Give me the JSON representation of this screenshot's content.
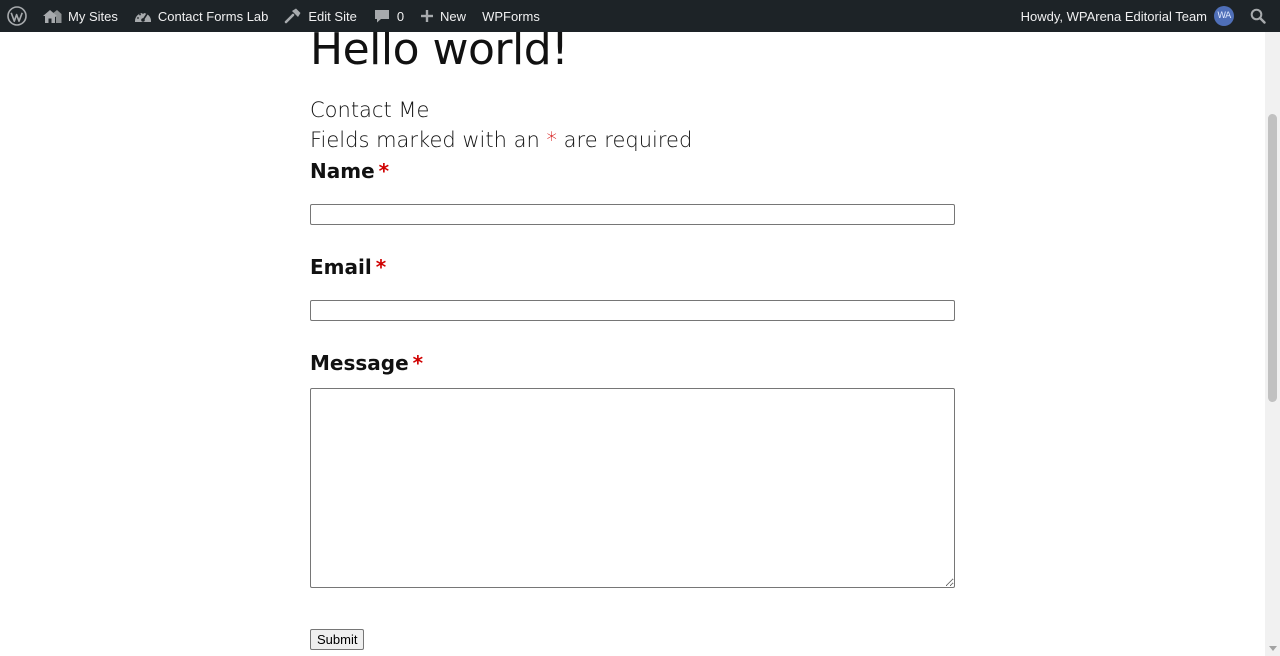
{
  "adminbar": {
    "my_sites": "My Sites",
    "site_name": "Contact Forms Lab",
    "edit_site": "Edit Site",
    "comments_count": "0",
    "new_label": "New",
    "wpforms": "WPForms",
    "howdy": "Howdy, WPArena Editorial Team",
    "avatar_initials": "WA",
    "icons": [
      "wordpress-icon",
      "my-sites-icon",
      "dashboard-icon",
      "edit-site-icon",
      "comment-icon",
      "plus-icon",
      "search-icon"
    ]
  },
  "post": {
    "title": "Hello world!"
  },
  "form": {
    "title": "Contact Me",
    "note_prefix": "Fields marked with an",
    "note_asterisk": "*",
    "note_suffix": "are required",
    "fields": {
      "name": {
        "label": "Name",
        "required_mark": "*",
        "value": ""
      },
      "email": {
        "label": "Email",
        "required_mark": "*",
        "value": ""
      },
      "message": {
        "label": "Message",
        "required_mark": "*",
        "value": ""
      }
    },
    "submit_label": "Submit"
  },
  "colors": {
    "adminbar_bg": "#1d2327",
    "adminbar_text": "#f0f0f1",
    "required": "#d00000",
    "avatar": "#4f6fb8"
  }
}
